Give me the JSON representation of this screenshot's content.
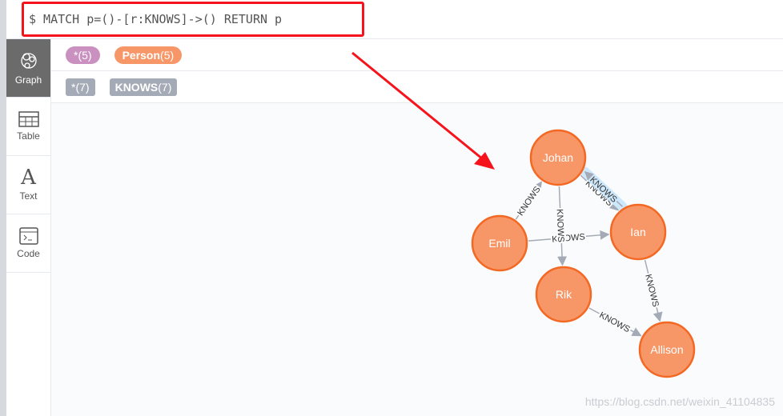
{
  "query": "$ MATCH p=()-[r:KNOWS]->() RETURN p",
  "sidebar": {
    "items": [
      {
        "label": "Graph",
        "icon": "graph-icon"
      },
      {
        "label": "Table",
        "icon": "table-icon"
      },
      {
        "label": "Text",
        "icon": "text-icon"
      },
      {
        "label": "Code",
        "icon": "code-icon"
      }
    ]
  },
  "legend": {
    "nodes": [
      {
        "label": "*",
        "count": "(5)",
        "color": "#c990c0"
      },
      {
        "label": "Person",
        "count": "(5)",
        "color": "#f79767"
      }
    ],
    "relationships": [
      {
        "label": "*",
        "count": "(7)"
      },
      {
        "label": "KNOWS",
        "count": "(7)"
      }
    ]
  },
  "graph": {
    "nodes": [
      "Johan",
      "Emil",
      "Ian",
      "Rik",
      "Allison"
    ],
    "edges": [
      {
        "from": "Emil",
        "to": "Johan",
        "label": "KNOWS"
      },
      {
        "from": "Johan",
        "to": "Ian",
        "label": "KNOWS"
      },
      {
        "from": "Ian",
        "to": "Johan",
        "label": "KNOWS",
        "selected": true
      },
      {
        "from": "Emil",
        "to": "Ian",
        "label": "KNOWS"
      },
      {
        "from": "Johan",
        "to": "Rik",
        "label": "KNOWS"
      },
      {
        "from": "Ian",
        "to": "Allison",
        "label": "KNOWS"
      },
      {
        "from": "Rik",
        "to": "Allison",
        "label": "KNOWS"
      }
    ]
  },
  "watermark": "https://blog.csdn.net/weixin_41104835"
}
